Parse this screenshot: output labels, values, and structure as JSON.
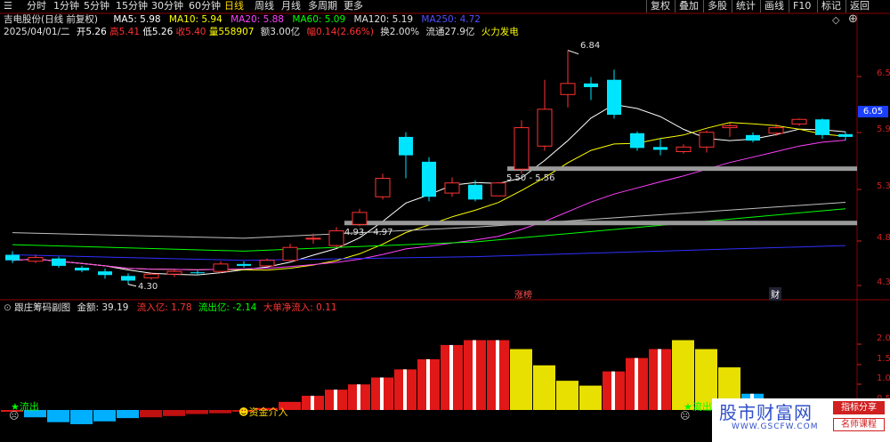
{
  "toolbar": {
    "periods": [
      "分时",
      "1分钟",
      "5分钟",
      "15分钟",
      "30分钟",
      "60分钟",
      "日线",
      "周线",
      "月线",
      "多周期",
      "更多"
    ],
    "active_period": "日线",
    "buttons": [
      "复权",
      "叠加",
      "多股",
      "统计",
      "画线",
      "F10",
      "标记",
      "返回"
    ]
  },
  "header": {
    "stock_name": "吉电股份(日线 前复权)",
    "ma5": "MA5: 5.98",
    "ma10": "MA10: 5.94",
    "ma20": "MA20: 5.88",
    "ma60": "MA60: 5.09",
    "ma120": "MA120: 5.19",
    "ma250": "MA250: 4.72",
    "date": "2025/04/01/二",
    "open": "开5.26",
    "high": "高5.41",
    "low": "低5.26",
    "close": "收5.40",
    "volume": "量558907",
    "amount": "额3.00亿",
    "change": "幅0.14(2.66%)",
    "turnover": "换2.00%",
    "float": "流通27.9亿",
    "concept": "火力发电"
  },
  "colors": {
    "up": "#ff3232",
    "down": "#00e5ff",
    "ma5": "#ffffff",
    "ma10": "#ffff00",
    "ma20": "#ff40ff",
    "ma60": "#00ff00",
    "ma120": "#c0c0c0",
    "ma250": "#3030ff",
    "current_price_bg": "#1a3fff"
  },
  "price_axis": {
    "ticks": [
      "6.5",
      "5.9",
      "5.3",
      "4.8",
      "4.3"
    ],
    "current": "6.05"
  },
  "annotations": {
    "peak": "6.84",
    "trough": "4.30",
    "band_high": "5.50 - 5.56",
    "band_low": "4.93 - 4.97",
    "limit_up": "涨榜",
    "finance": "财"
  },
  "sub_header": {
    "name": "跟庄筹码副图",
    "amount": "金额: 39.19",
    "inflow": "流入亿: 1.78",
    "outflow": "流出亿: -2.14",
    "big_net": "大单净流入: 0.11"
  },
  "sub_axis": [
    "2.0",
    "1.5",
    "1.0",
    "0.5"
  ],
  "sub_labels": {
    "out1": "流出",
    "out2": "流出",
    "fund": "资金介入"
  },
  "watermark": {
    "title": "股市财富网",
    "url": "WWW.GSCFW.COM",
    "tag1": "指标分享",
    "tag2": "名师课程"
  },
  "chart_data": {
    "type": "candlestick",
    "ylim": [
      4.2,
      7.0
    ],
    "candles": [
      {
        "o": 4.62,
        "c": 4.56,
        "h": 4.66,
        "l": 4.53
      },
      {
        "o": 4.55,
        "c": 4.59,
        "h": 4.62,
        "l": 4.53
      },
      {
        "o": 4.58,
        "c": 4.5,
        "h": 4.6,
        "l": 4.48
      },
      {
        "o": 4.48,
        "c": 4.45,
        "h": 4.5,
        "l": 4.43
      },
      {
        "o": 4.44,
        "c": 4.4,
        "h": 4.47,
        "l": 4.36
      },
      {
        "o": 4.39,
        "c": 4.34,
        "h": 4.42,
        "l": 4.3
      },
      {
        "o": 4.37,
        "c": 4.41,
        "h": 4.43,
        "l": 4.35
      },
      {
        "o": 4.41,
        "c": 4.44,
        "h": 4.46,
        "l": 4.38
      },
      {
        "o": 4.43,
        "c": 4.42,
        "h": 4.45,
        "l": 4.4
      },
      {
        "o": 4.44,
        "c": 4.52,
        "h": 4.55,
        "l": 4.42
      },
      {
        "o": 4.52,
        "c": 4.5,
        "h": 4.55,
        "l": 4.48
      },
      {
        "o": 4.5,
        "c": 4.56,
        "h": 4.58,
        "l": 4.49
      },
      {
        "o": 4.56,
        "c": 4.7,
        "h": 4.74,
        "l": 4.55
      },
      {
        "o": 4.8,
        "c": 4.8,
        "h": 4.85,
        "l": 4.74
      },
      {
        "o": 4.72,
        "c": 4.88,
        "h": 4.92,
        "l": 4.7
      },
      {
        "o": 4.95,
        "c": 5.08,
        "h": 5.12,
        "l": 4.93
      },
      {
        "o": 5.25,
        "c": 5.45,
        "h": 5.5,
        "l": 5.22
      },
      {
        "o": 5.9,
        "c": 5.7,
        "h": 5.95,
        "l": 5.45
      },
      {
        "o": 5.63,
        "c": 5.25,
        "h": 5.68,
        "l": 5.2
      },
      {
        "o": 5.29,
        "c": 5.4,
        "h": 5.46,
        "l": 5.25
      },
      {
        "o": 5.38,
        "c": 5.22,
        "h": 5.43,
        "l": 5.2
      },
      {
        "o": 5.26,
        "c": 5.4,
        "h": 5.41,
        "l": 5.26
      },
      {
        "o": 5.55,
        "c": 6.0,
        "h": 6.08,
        "l": 5.5
      },
      {
        "o": 5.8,
        "c": 6.2,
        "h": 6.52,
        "l": 5.75
      },
      {
        "o": 6.36,
        "c": 6.48,
        "h": 6.84,
        "l": 6.22
      },
      {
        "o": 6.48,
        "c": 6.44,
        "h": 6.55,
        "l": 6.3
      },
      {
        "o": 6.52,
        "c": 6.14,
        "h": 6.63,
        "l": 6.1
      },
      {
        "o": 5.94,
        "c": 5.78,
        "h": 5.96,
        "l": 5.75
      },
      {
        "o": 5.79,
        "c": 5.76,
        "h": 5.88,
        "l": 5.7
      },
      {
        "o": 5.74,
        "c": 5.79,
        "h": 5.82,
        "l": 5.72
      },
      {
        "o": 5.79,
        "c": 5.95,
        "h": 5.97,
        "l": 5.73
      },
      {
        "o": 6.0,
        "c": 6.02,
        "h": 6.05,
        "l": 5.9
      },
      {
        "o": 5.92,
        "c": 5.86,
        "h": 5.95,
        "l": 5.84
      },
      {
        "o": 5.94,
        "c": 6.0,
        "h": 6.04,
        "l": 5.91
      },
      {
        "o": 6.04,
        "c": 6.09,
        "h": 6.1,
        "l": 6.02
      },
      {
        "o": 6.09,
        "c": 5.92,
        "h": 6.1,
        "l": 5.88
      },
      {
        "o": 5.93,
        "c": 5.9,
        "h": 5.96,
        "l": 5.86
      }
    ],
    "sub_values": [
      0.0,
      -0.18,
      -0.3,
      -0.35,
      -0.28,
      -0.2,
      -0.18,
      -0.15,
      -0.1,
      -0.08,
      -0.02,
      0.05,
      0.2,
      0.35,
      0.5,
      0.63,
      0.8,
      1.0,
      1.25,
      1.6,
      1.72,
      1.72,
      1.5,
      1.1,
      0.72,
      0.6,
      0.95,
      1.28,
      1.5,
      1.72,
      1.5,
      1.05,
      0.4,
      0.0,
      -0.15,
      -0.25,
      -0.3
    ],
    "sub_ylim": [
      -0.55,
      2.3
    ]
  }
}
